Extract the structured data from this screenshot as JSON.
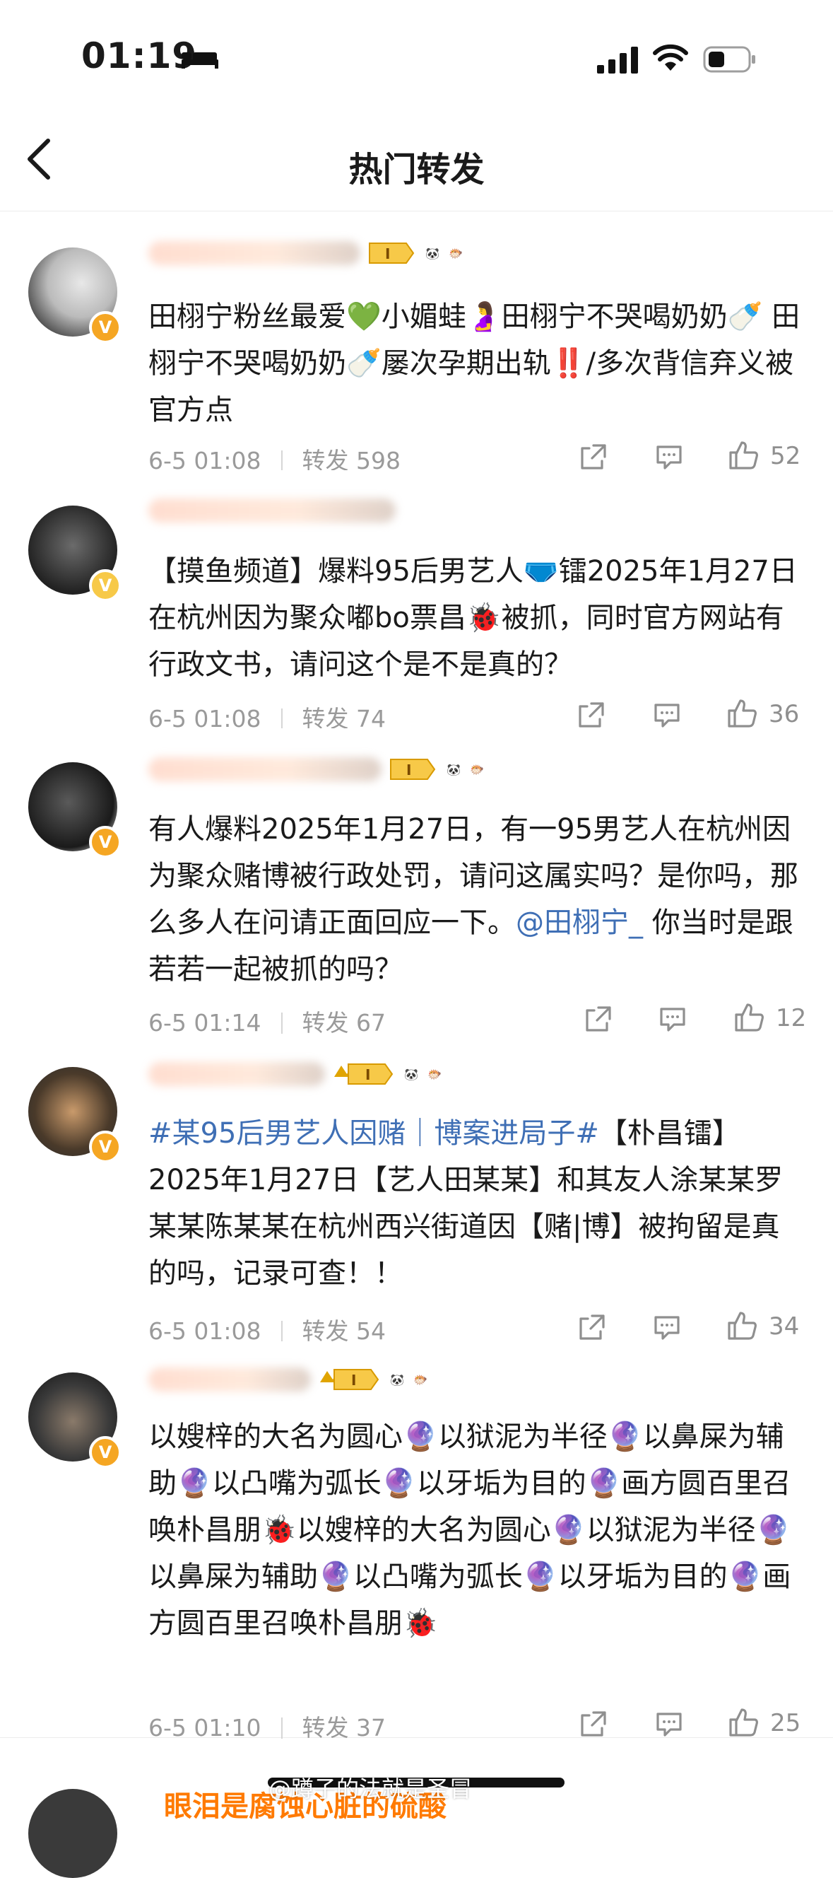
{
  "status_bar": {
    "time": "01:19",
    "icons": [
      "bed-icon",
      "signal-icon",
      "wifi-icon",
      "battery-icon"
    ]
  },
  "nav": {
    "title": "热门转发",
    "back_icon": "chevron-left-icon"
  },
  "posts": [
    {
      "content": "田栩宁粉丝最爱💚小媚蛙🤰田栩宁不哭喝奶奶🍼 田栩宁不哭喝奶奶🍼屡次孕期出轨‼️/多次背信弃义被官方点",
      "time": "6-5 01:08",
      "repost_label": "转发",
      "repost_count": "598",
      "likes": "52"
    },
    {
      "content": "【摸鱼频道】爆料95后男艺人🩲镭2025年1月27日在杭州因为聚众嘟bo票昌🐞被抓，同时官方网站有行政文书，请问这个是不是真的？",
      "time": "6-5 01:08",
      "repost_label": "转发",
      "repost_count": "74",
      "likes": "36"
    },
    {
      "content_pre": "有人爆料2025年1月27日，有一95男艺人在杭州因为聚众赌博被行政处罚，请问这属实吗？是你吗，那么多人在问请正面回应一下。",
      "mention": "@田栩宁_",
      "content_post": " 你当时是跟若若一起被抓的吗？",
      "time": "6-5 01:14",
      "repost_label": "转发",
      "repost_count": "67",
      "likes": "12"
    },
    {
      "topic": "#某95后男艺人因赌｜博案进局子#",
      "content_post": "【朴昌镭】2025年1月27日【艺人田某某】和其友人涂某某罗某某陈某某在杭州西兴街道因【赌|博】被拘留是真的吗，记录可查！！",
      "time": "6-5 01:08",
      "repost_label": "转发",
      "repost_count": "54",
      "likes": "34"
    },
    {
      "content": "以嫂梓的大名为圆心🔮以狱泥为半径🔮以鼻屎为辅助🔮以凸嘴为弧长🔮以牙垢为目的🔮画方圆百里召唤朴昌朋🐞以嫂梓的大名为圆心🔮以狱泥为半径🔮以鼻屎为辅助🔮以凸嘴为弧长🔮以牙垢为目的🔮画方圆百里召唤朴昌朋🐞",
      "time": "6-5 01:10",
      "repost_label": "转发",
      "repost_count": "37",
      "likes": "25"
    }
  ],
  "last_visible_name": "眼泪是腐蚀心脏的硫酸",
  "watermark": "@蹲子的法就是圣冒",
  "colors": {
    "link": "#3f6fb5",
    "meta": "#9a9a9a",
    "badge": "#f5a623"
  }
}
